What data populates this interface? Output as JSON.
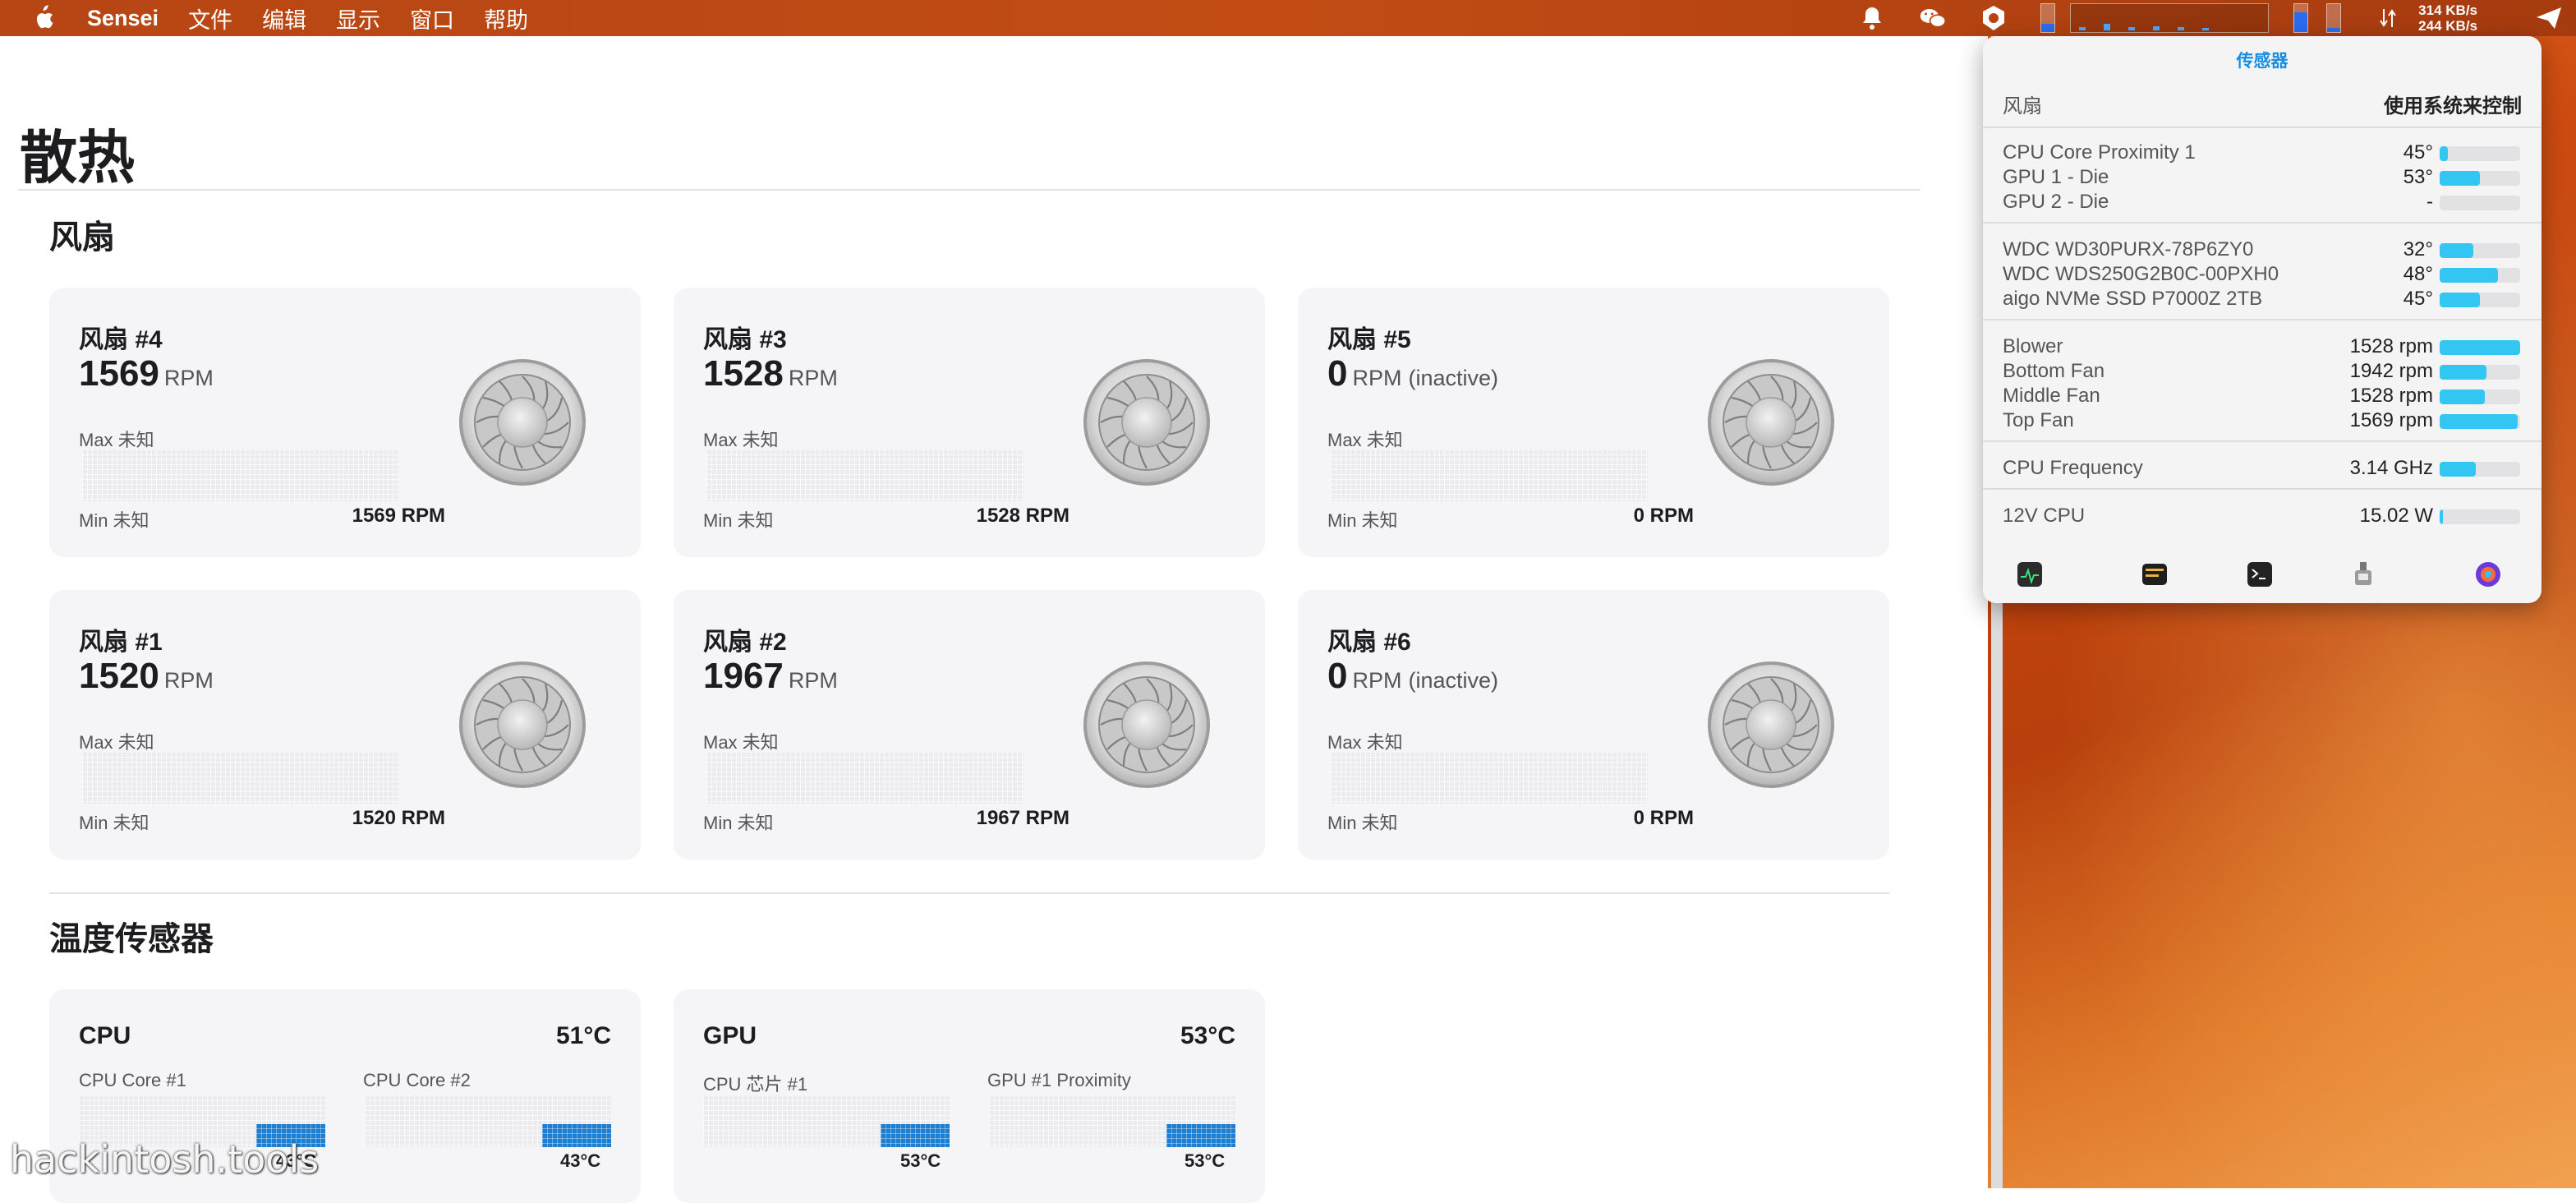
{
  "menubar": {
    "app_name": "Sensei",
    "menus": [
      "文件",
      "编辑",
      "显示",
      "窗口",
      "帮助"
    ],
    "net_up": "314 KB/s",
    "net_down": "244 KB/s"
  },
  "page": {
    "title": "散热",
    "fans_heading": "风扇",
    "temps_heading": "温度传感器"
  },
  "fans": [
    {
      "name": "风扇 #4",
      "rpm": "1569",
      "unit": "RPM",
      "status": "",
      "max": "Max 未知",
      "min": "Min 未知",
      "current": "1569 RPM"
    },
    {
      "name": "风扇 #3",
      "rpm": "1528",
      "unit": "RPM",
      "status": "",
      "max": "Max 未知",
      "min": "Min 未知",
      "current": "1528 RPM"
    },
    {
      "name": "风扇 #5",
      "rpm": "0",
      "unit": "RPM",
      "status": "(inactive)",
      "max": "Max 未知",
      "min": "Min 未知",
      "current": "0 RPM"
    },
    {
      "name": "风扇 #1",
      "rpm": "1520",
      "unit": "RPM",
      "status": "",
      "max": "Max 未知",
      "min": "Min 未知",
      "current": "1520 RPM"
    },
    {
      "name": "风扇 #2",
      "rpm": "1967",
      "unit": "RPM",
      "status": "",
      "max": "Max 未知",
      "min": "Min 未知",
      "current": "1967 RPM"
    },
    {
      "name": "风扇 #6",
      "rpm": "0",
      "unit": "RPM",
      "status": "(inactive)",
      "max": "Max 未知",
      "min": "Min 未知",
      "current": "0 RPM"
    }
  ],
  "temps": [
    {
      "name": "CPU",
      "value": "51°C",
      "sensors": [
        {
          "label": "CPU Core #1",
          "value": "43°C"
        },
        {
          "label": "CPU Core #2",
          "value": "43°C"
        }
      ]
    },
    {
      "name": "GPU",
      "value": "53°C",
      "sensors": [
        {
          "label": "CPU 芯片 #1",
          "value": "53°C"
        },
        {
          "label": "GPU #1 Proximity",
          "value": "53°C"
        }
      ]
    }
  ],
  "popover": {
    "title": "传感器",
    "header_left": "风扇",
    "header_right": "使用系统来控制",
    "groups": [
      [
        {
          "label": "CPU Core Proximity 1",
          "value": "45°",
          "fill": 0.1
        },
        {
          "label": "GPU 1 - Die",
          "value": "53°",
          "fill": 0.5
        },
        {
          "label": "GPU 2 - Die",
          "value": "-",
          "fill": 0
        }
      ],
      [
        {
          "label": "WDC WD30PURX-78P6ZY0",
          "value": "32°",
          "fill": 0.42
        },
        {
          "label": "WDC WDS250G2B0C-00PXH0",
          "value": "48°",
          "fill": 0.72
        },
        {
          "label": "aigo NVMe SSD P7000Z 2TB",
          "value": "45°",
          "fill": 0.5
        }
      ],
      [
        {
          "label": "Blower",
          "value": "1528 rpm",
          "fill": 1.0
        },
        {
          "label": "Bottom Fan",
          "value": "1942 rpm",
          "fill": 0.58
        },
        {
          "label": "Middle Fan",
          "value": "1528 rpm",
          "fill": 0.56
        },
        {
          "label": "Top Fan",
          "value": "1569 rpm",
          "fill": 0.97
        }
      ],
      [
        {
          "label": "CPU Frequency",
          "value": "3.14 GHz",
          "fill": 0.45
        }
      ],
      [
        {
          "label": "12V CPU",
          "value": "15.02 W",
          "fill": 0.04
        }
      ]
    ]
  },
  "watermark": "hackintosh.tools",
  "colors": {
    "accent": "#1a8fe0",
    "bar_fill": "#33c6f2",
    "graph_fill": "#1e7fd0",
    "card_bg": "#f5f5f7"
  }
}
